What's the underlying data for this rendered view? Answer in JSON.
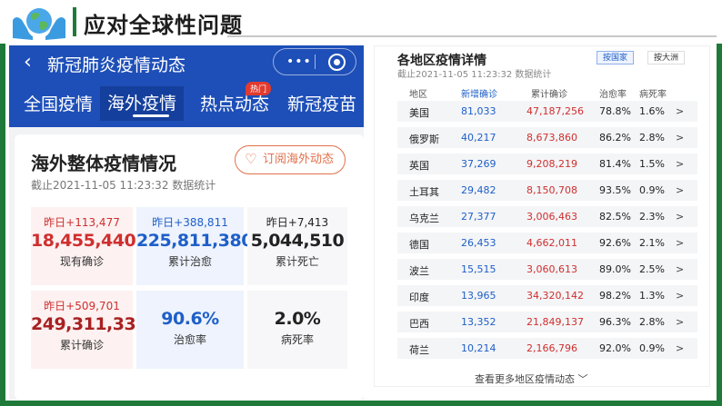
{
  "slide": {
    "title": "应对全球性问题"
  },
  "phone": {
    "back_icon": "back-arrow-icon",
    "header_title": "新冠肺炎疫情动态",
    "capsule_dots": "•••",
    "tabs": [
      {
        "label": "全国疫情"
      },
      {
        "label": "海外疫情"
      },
      {
        "label": "热点动态"
      },
      {
        "label": "新冠疫苗"
      }
    ],
    "hot_badge": "热门",
    "card": {
      "title": "海外整体疫情情况",
      "date": "截止2021-11-05 11:23:32 数据统计",
      "subscribe_label": "订阅海外动态",
      "stats": [
        {
          "delta": "昨日+113,477",
          "value": "18,455,440",
          "label": "现有确诊"
        },
        {
          "delta": "昨日+388,811",
          "value": "225,811,380",
          "label": "累计治愈"
        },
        {
          "delta": "昨日+7,413",
          "value": "5,044,510",
          "label": "累计死亡"
        },
        {
          "delta": "昨日+509,701",
          "value": "249,311,330",
          "label": "累计确诊"
        },
        {
          "delta": "",
          "value": "90.6%",
          "label": "治愈率"
        },
        {
          "delta": "",
          "value": "2.0%",
          "label": "病死率"
        }
      ]
    }
  },
  "table": {
    "title": "各地区疫情详情",
    "date": "截止2021-11-05 11:23:32 数据统计",
    "btn_by_country": "按国家",
    "btn_by_continent": "按大洲",
    "headers": {
      "region": "地区",
      "new": "新增确诊",
      "total": "累计确诊",
      "cure": "治愈率",
      "death": "病死率"
    },
    "rows": [
      {
        "name": "美国",
        "new": "81,033",
        "total": "47,187,256",
        "cure": "78.8%",
        "death": "1.6%",
        "arrow": ">"
      },
      {
        "name": "俄罗斯",
        "new": "40,217",
        "total": "8,673,860",
        "cure": "86.2%",
        "death": "2.8%",
        "arrow": ">"
      },
      {
        "name": "英国",
        "new": "37,269",
        "total": "9,208,219",
        "cure": "81.4%",
        "death": "1.5%",
        "arrow": ">"
      },
      {
        "name": "土耳其",
        "new": "29,482",
        "total": "8,150,708",
        "cure": "93.5%",
        "death": "0.9%",
        "arrow": ">"
      },
      {
        "name": "乌克兰",
        "new": "27,377",
        "total": "3,006,463",
        "cure": "82.5%",
        "death": "2.3%",
        "arrow": ">"
      },
      {
        "name": "德国",
        "new": "26,453",
        "total": "4,662,011",
        "cure": "92.6%",
        "death": "2.1%",
        "arrow": ">"
      },
      {
        "name": "波兰",
        "new": "15,515",
        "total": "3,060,613",
        "cure": "89.0%",
        "death": "2.5%",
        "arrow": ">"
      },
      {
        "name": "印度",
        "new": "13,965",
        "total": "34,320,142",
        "cure": "98.2%",
        "death": "1.3%",
        "arrow": ">"
      },
      {
        "name": "巴西",
        "new": "13,352",
        "total": "21,849,137",
        "cure": "96.3%",
        "death": "2.8%",
        "arrow": ">"
      },
      {
        "name": "荷兰",
        "new": "10,214",
        "total": "2,166,796",
        "cure": "92.0%",
        "death": "0.9%",
        "arrow": ">"
      }
    ],
    "more_label": "查看更多地区疫情动态 ﹀"
  },
  "colors": {
    "brand_green": "#1f7a3a",
    "header_blue": "#1e4fb8",
    "confirmed_red": "#cf2f2f",
    "cured_blue": "#1e5fc8",
    "subscribe_orange": "#e2704b"
  }
}
